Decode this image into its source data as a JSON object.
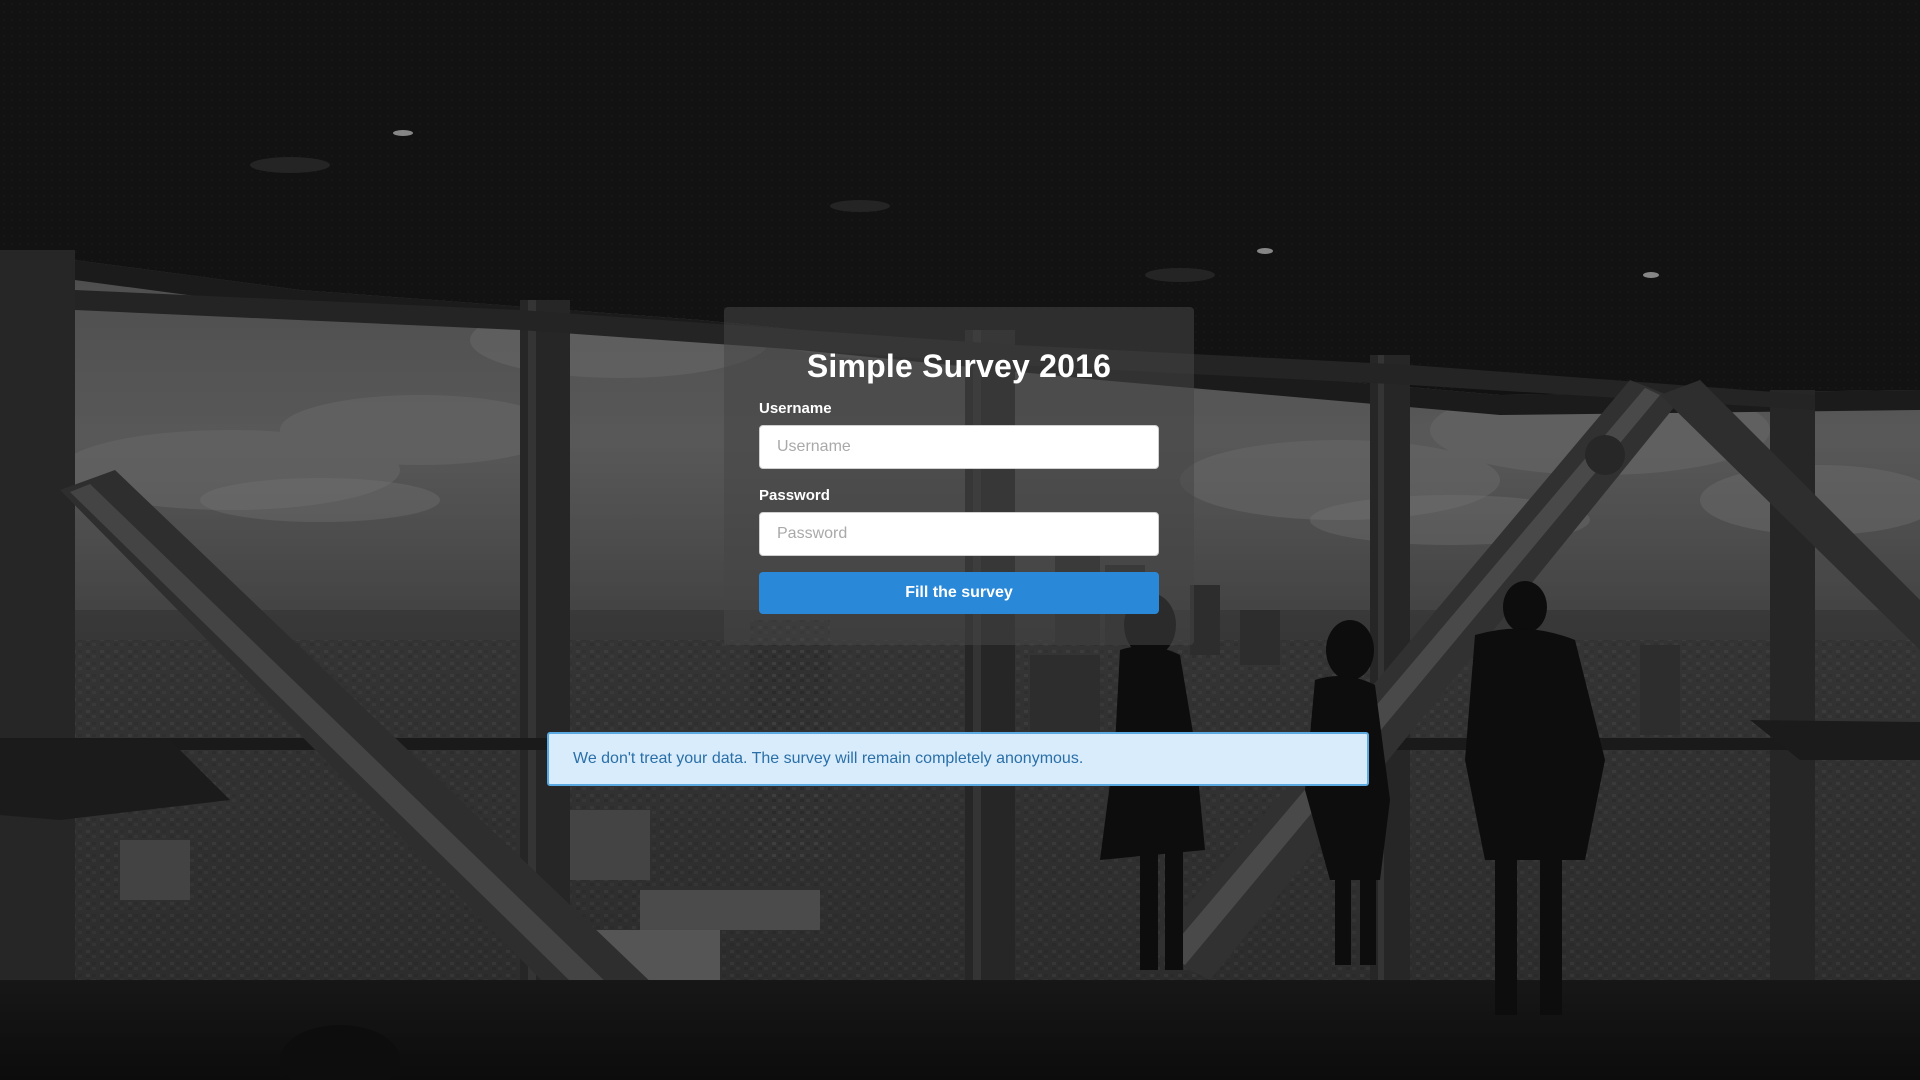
{
  "form": {
    "title": "Simple Survey 2016",
    "username_label": "Username",
    "username_placeholder": "Username",
    "username_value": "",
    "password_label": "Password",
    "password_placeholder": "Password",
    "password_value": "",
    "submit_label": "Fill the survey"
  },
  "notice": {
    "text": "We don't treat your data. The survey will remain completely anonymous."
  },
  "colors": {
    "button": "#2a88d8",
    "notice_background": "#d9ecfb",
    "notice_text": "#2a6fa8",
    "panel_overlay": "rgba(70,70,70,0.55)"
  }
}
